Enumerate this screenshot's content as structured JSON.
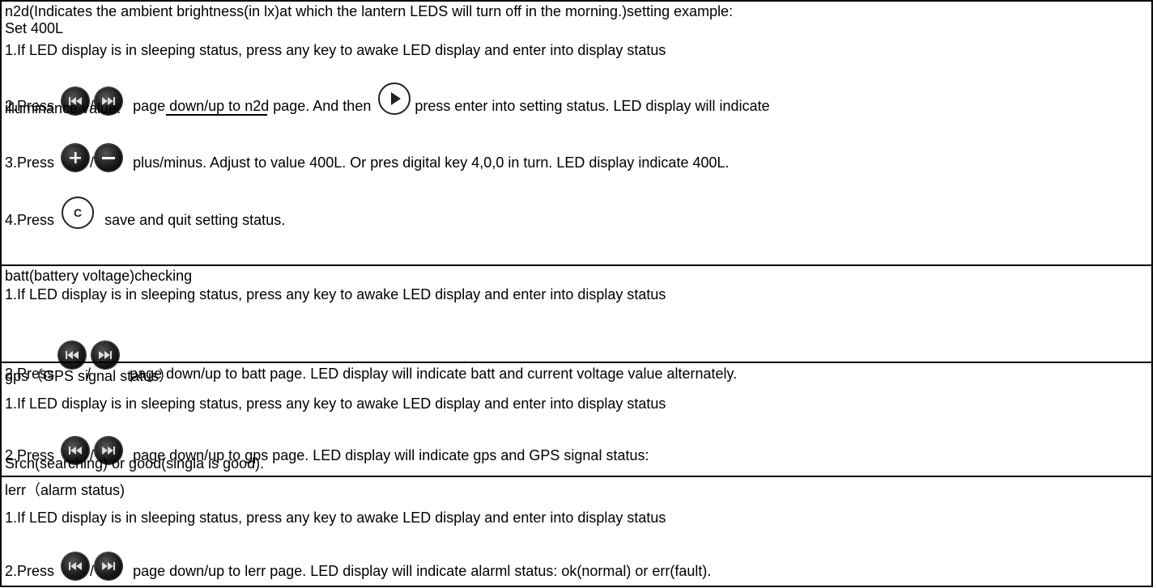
{
  "sections": [
    {
      "title": "n2d(Indicates the ambient brightness(in lx)at which the lantern LEDS will turn off in the morning.)setting example:",
      "subtitle": "Set 400L",
      "step1": "1.If LED display is in sleeping status, press any key to awake LED display and enter into display status",
      "step2_prefix": "2.Press",
      "step2_mid": "page down/up to n2d page. And then",
      "step2_suffix": "press enter into setting status. LED display will indicate",
      "step2_cont": "illuminance value.",
      "step3_prefix": "3.Press",
      "step3_suffix": "plus/minus. Adjust to value 400L. Or pres digital key 4,0,0 in turn. LED display indicate 400L.",
      "step4_prefix": "4.Press",
      "step4_suffix": "save and quit setting status."
    },
    {
      "title": "batt(battery voltage)checking",
      "step1": "1.If LED display is in sleeping status, press any key to awake LED display and enter into display status",
      "step2_prefix": "2.Press",
      "step2_suffix": "page down/up to batt page. LED display will indicate batt and current voltage value alternately."
    },
    {
      "title": "gps（GPS signal status）",
      "step1": "1.If LED display is in sleeping status, press any key to awake LED display and enter into display status",
      "step2_prefix": "2.Press",
      "step2_suffix": "page down/up to gps page. LED display will indicate gps and GPS signal status:",
      "step2_cont": "Srch(searching) or good(singla is good)."
    },
    {
      "title": "lerr（alarm status)",
      "step1": "1.If LED display is in sleeping status, press any key to awake LED display and enter into display status",
      "step2_prefix": "2.Press",
      "step2_suffix": "page down/up to lerr page. LED display will indicate alarml status: ok(normal) or err(fault)."
    }
  ],
  "separator": "/",
  "icons": {
    "prev": "previous-track-icon",
    "next": "next-track-icon",
    "play": "play-enter-icon",
    "plus": "plus-icon",
    "minus": "minus-icon",
    "clear": "c-save-icon"
  }
}
